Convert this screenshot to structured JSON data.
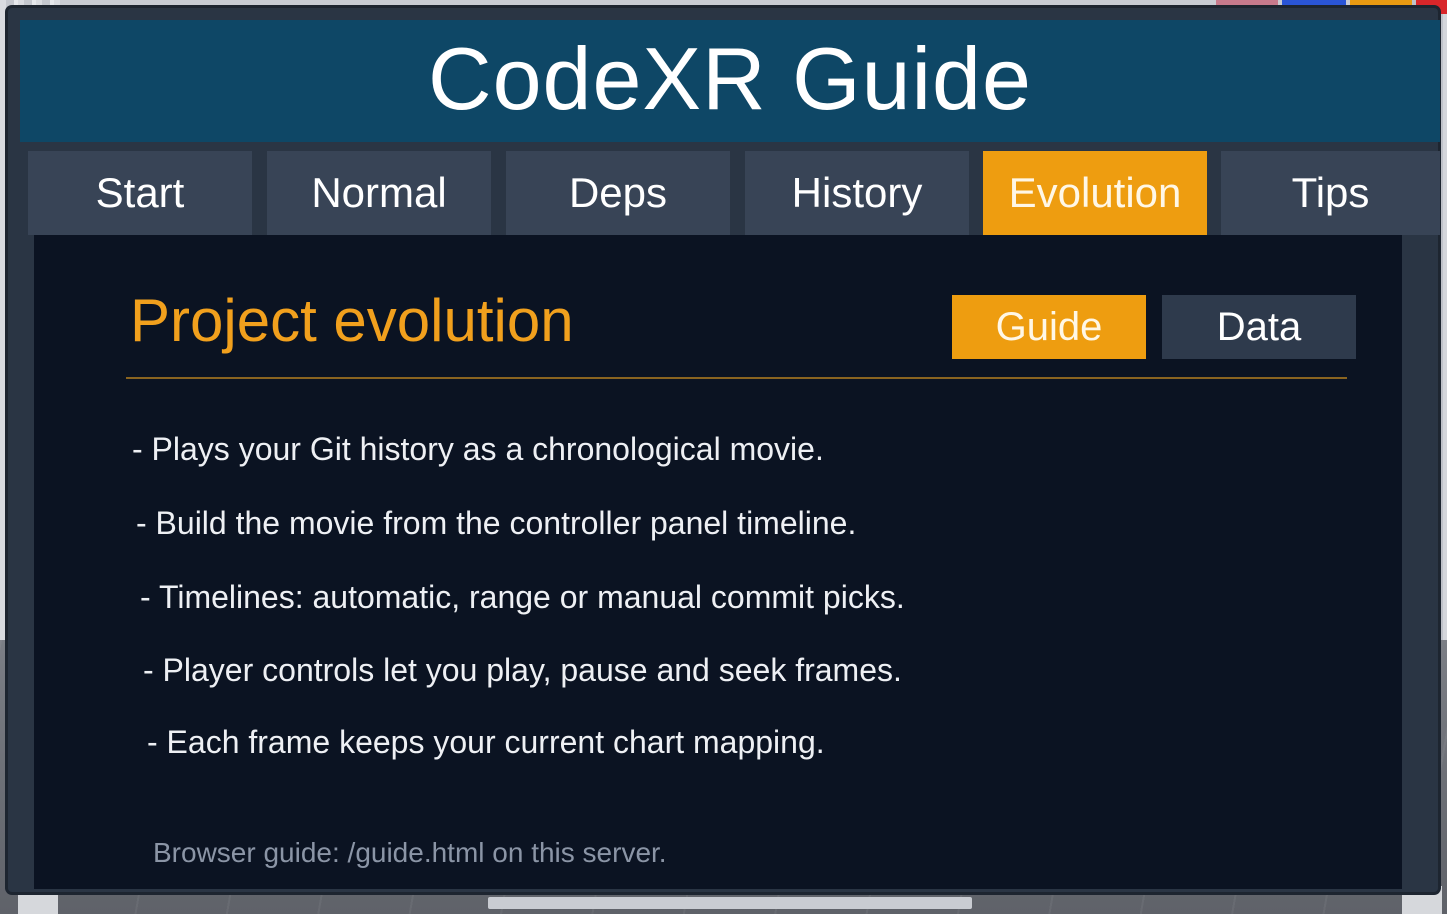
{
  "header": {
    "title": "CodeXR Guide"
  },
  "tabs": [
    {
      "label": "Start",
      "active": false
    },
    {
      "label": "Normal",
      "active": false
    },
    {
      "label": "Deps",
      "active": false
    },
    {
      "label": "History",
      "active": false
    },
    {
      "label": "Evolution",
      "active": true
    },
    {
      "label": "Tips",
      "active": false
    }
  ],
  "section": {
    "title": "Project evolution",
    "subtabs": [
      {
        "label": "Guide",
        "active": true
      },
      {
        "label": "Data",
        "active": false
      }
    ],
    "bullets": [
      "- Plays your Git history as a chronological movie.",
      "- Build the movie from the controller panel timeline.",
      "- Timelines: automatic, range or manual commit picks.",
      "- Player controls let you play, pause and seek frames.",
      "- Each frame keeps your current chart mapping."
    ],
    "footer": "Browser guide: /guide.html on this server."
  },
  "colors": {
    "header_bg": "#0e4766",
    "accent": "#ee9d10",
    "tab_bg": "#384456",
    "content_bg": "#0b1322",
    "title_text": "#f1a01d"
  }
}
